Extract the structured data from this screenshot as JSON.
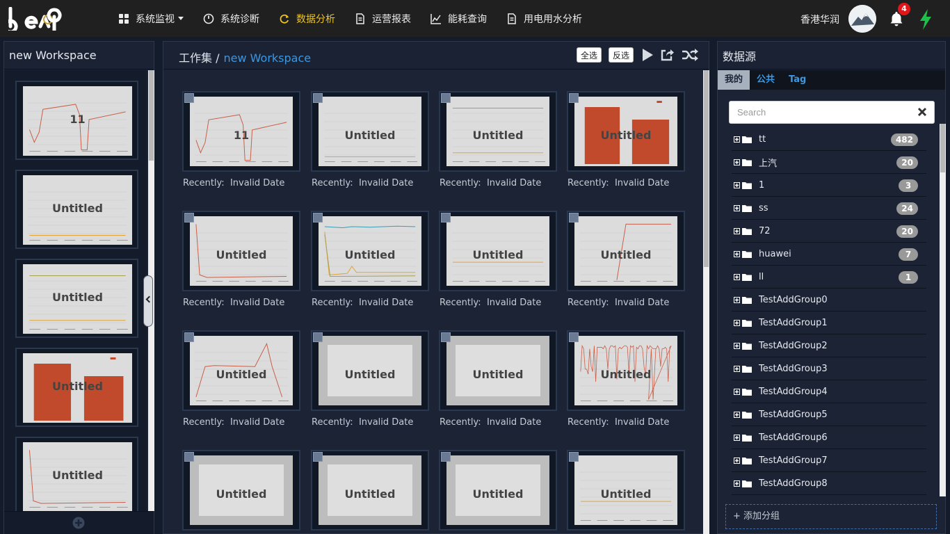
{
  "brand": {
    "logo_text": "beep"
  },
  "nav": {
    "items": [
      {
        "label": "系统监视",
        "icon": "grid-icon",
        "dropdown": true,
        "active": false
      },
      {
        "label": "系统诊断",
        "icon": "gauge-icon",
        "dropdown": false,
        "active": false
      },
      {
        "label": "数据分析",
        "icon": "refresh-icon",
        "dropdown": false,
        "active": true
      },
      {
        "label": "运营报表",
        "icon": "document-icon",
        "dropdown": false,
        "active": false
      },
      {
        "label": "能耗查询",
        "icon": "line-chart-icon",
        "dropdown": false,
        "active": false
      },
      {
        "label": "用电用水分析",
        "icon": "document-icon",
        "dropdown": false,
        "active": false
      }
    ],
    "user": "香港华润",
    "notifications": "4",
    "accent_active": "#f0c419",
    "alert_badge_color": "#e0161b"
  },
  "left": {
    "title": "new Workspace"
  },
  "left_thumbs": [
    {
      "title": "11",
      "chart": "line-dip"
    },
    {
      "title": "Untitled",
      "chart": "flat"
    },
    {
      "title": "Untitled",
      "chart": "two-lines"
    },
    {
      "title": "Untitled",
      "chart": "bars"
    },
    {
      "title": "Untitled",
      "chart": "drop"
    }
  ],
  "center": {
    "crumb_root": "工作集 /",
    "crumb_current": "new Workspace",
    "select_all": "全选",
    "invert": "反选",
    "recent_label": "Recently:",
    "recent_value": "Invalid Date"
  },
  "cards": [
    {
      "title": "11",
      "chart": "line-dip"
    },
    {
      "title": "Untitled",
      "chart": "flat"
    },
    {
      "title": "Untitled",
      "chart": "two-lines"
    },
    {
      "title": "Untitled",
      "chart": "bars"
    },
    {
      "title": "Untitled",
      "chart": "drop"
    },
    {
      "title": "Untitled",
      "chart": "multi"
    },
    {
      "title": "Untitled",
      "chart": "flat-mid"
    },
    {
      "title": "Untitled",
      "chart": "rise"
    },
    {
      "title": "Untitled",
      "chart": "hump"
    },
    {
      "title": "Untitled",
      "chart": "blank"
    },
    {
      "title": "Untitled",
      "chart": "blank"
    },
    {
      "title": "Untitled",
      "chart": "spikes"
    },
    {
      "title": "Untitled",
      "chart": "blank"
    },
    {
      "title": "Untitled",
      "chart": "blank"
    },
    {
      "title": "Untitled",
      "chart": "blank"
    },
    {
      "title": "Untitled",
      "chart": "flat-mid"
    }
  ],
  "datasource": {
    "title": "数据源",
    "tabs": [
      "我的",
      "公共",
      "Tag"
    ],
    "active_tab": 0,
    "search_placeholder": "Search",
    "groups": [
      {
        "name": "tt",
        "count": "482"
      },
      {
        "name": "上汽",
        "count": "20"
      },
      {
        "name": "1",
        "count": "3"
      },
      {
        "name": "ss",
        "count": "24"
      },
      {
        "name": "72",
        "count": "20"
      },
      {
        "name": "huawei",
        "count": "7"
      },
      {
        "name": "ll",
        "count": "1"
      },
      {
        "name": "TestAddGroup0",
        "count": ""
      },
      {
        "name": "TestAddGroup1",
        "count": ""
      },
      {
        "name": "TestAddGroup2",
        "count": ""
      },
      {
        "name": "TestAddGroup3",
        "count": ""
      },
      {
        "name": "TestAddGroup4",
        "count": ""
      },
      {
        "name": "TestAddGroup5",
        "count": ""
      },
      {
        "name": "TestAddGroup6",
        "count": ""
      },
      {
        "name": "TestAddGroup7",
        "count": ""
      },
      {
        "name": "TestAddGroup8",
        "count": ""
      }
    ],
    "add_group": "+ 添加分组"
  }
}
